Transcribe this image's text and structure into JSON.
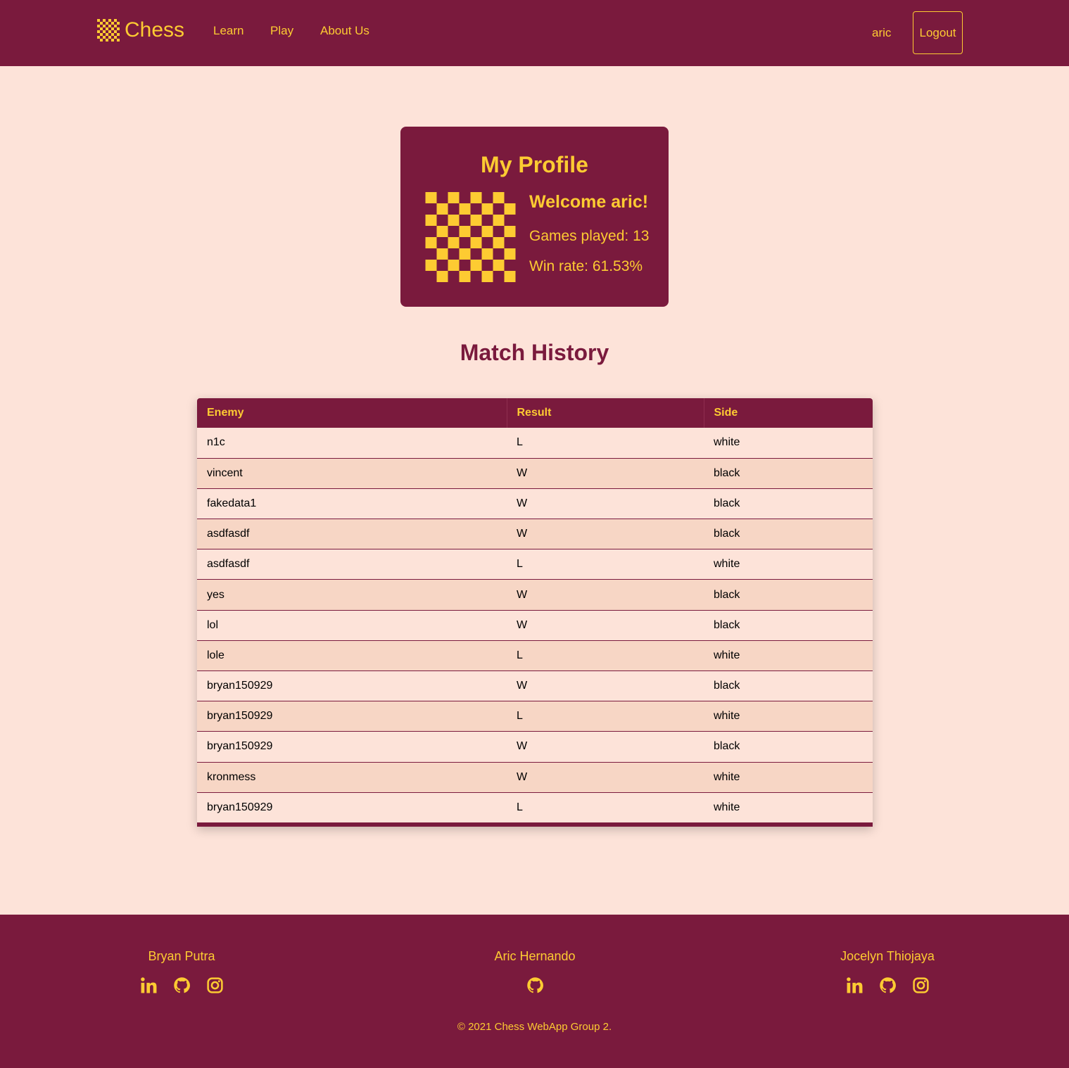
{
  "navbar": {
    "brand": "Chess",
    "links": [
      "Learn",
      "Play",
      "About Us"
    ],
    "username": "aric",
    "logout_label": "Logout"
  },
  "profile": {
    "title": "My Profile",
    "welcome": "Welcome aric!",
    "games_played": "Games played: 13",
    "win_rate": "Win rate: 61.53%"
  },
  "match_history": {
    "title": "Match History",
    "columns": [
      "Enemy",
      "Result",
      "Side"
    ],
    "rows": [
      [
        "n1c",
        "L",
        "white"
      ],
      [
        "vincent",
        "W",
        "black"
      ],
      [
        "fakedata1",
        "W",
        "black"
      ],
      [
        "asdfasdf",
        "W",
        "black"
      ],
      [
        "asdfasdf",
        "L",
        "white"
      ],
      [
        "yes",
        "W",
        "black"
      ],
      [
        "lol",
        "W",
        "black"
      ],
      [
        "lole",
        "L",
        "white"
      ],
      [
        "bryan150929",
        "W",
        "black"
      ],
      [
        "bryan150929",
        "L",
        "white"
      ],
      [
        "bryan150929",
        "W",
        "black"
      ],
      [
        "kronmess",
        "W",
        "white"
      ],
      [
        "bryan150929",
        "L",
        "white"
      ]
    ]
  },
  "footer": {
    "members": [
      {
        "name": "Bryan Putra",
        "icons": [
          "linkedin-icon",
          "github-icon",
          "instagram-icon"
        ]
      },
      {
        "name": "Aric Hernando",
        "icons": [
          "github-icon"
        ]
      },
      {
        "name": "Jocelyn Thiojaya",
        "icons": [
          "linkedin-icon",
          "github-icon",
          "instagram-icon"
        ]
      }
    ],
    "copyright": "© 2021 Chess WebApp Group 2."
  },
  "colors": {
    "primary": "#7a1a3d",
    "accent": "#fdcb32",
    "background": "#fde3d9",
    "row_alt": "#f7d6c5"
  }
}
